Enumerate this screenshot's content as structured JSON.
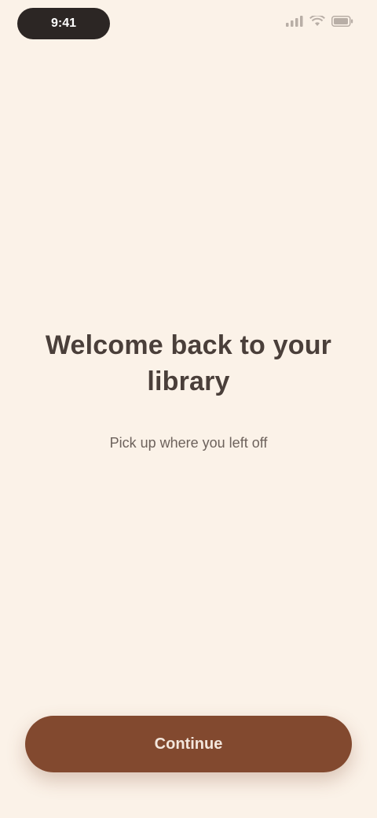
{
  "status_bar": {
    "time": "9:41"
  },
  "main": {
    "headline": "Welcome back to your library",
    "subtitle": "Pick up where you left off"
  },
  "cta": {
    "label": "Continue"
  },
  "icons": {
    "signal": "signal-icon",
    "wifi": "wifi-icon",
    "battery": "battery-icon"
  },
  "colors": {
    "background": "#fbf2e8",
    "accent": "#82492f",
    "text_primary": "#4a3f3a",
    "text_secondary": "#6d625c",
    "time_pill": "#2c2624"
  }
}
